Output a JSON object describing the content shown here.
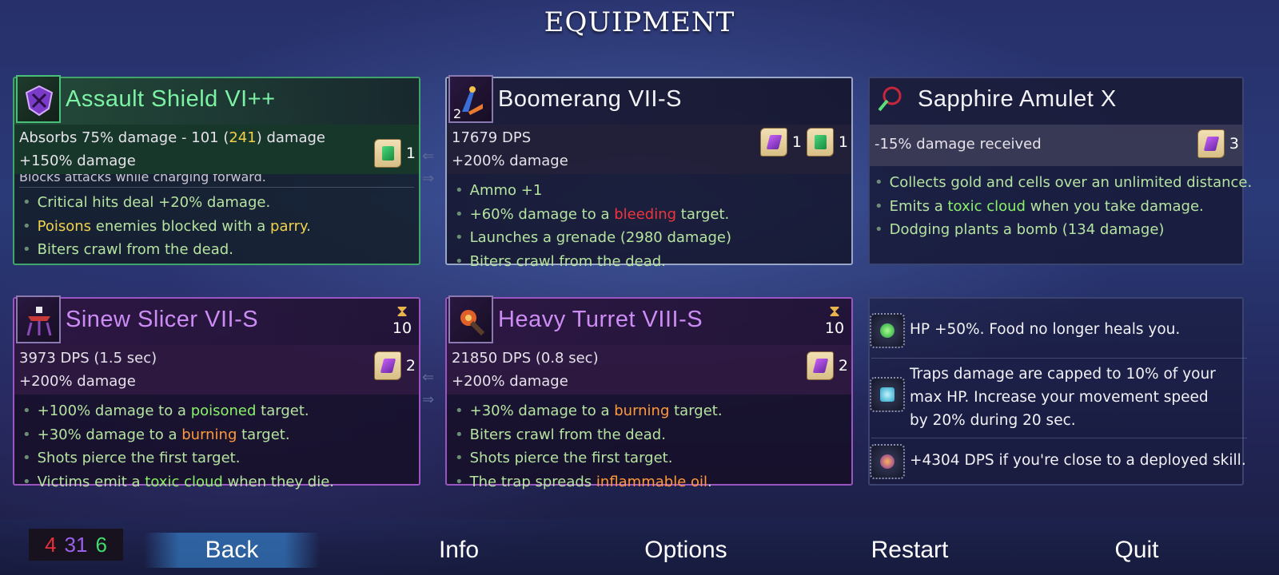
{
  "screen_title": "EQUIPMENT",
  "cards": {
    "shield": {
      "name": "Assault Shield VI++",
      "stat1_a": "Absorbs 75% damage - 101 (",
      "stat1_b": "241",
      "stat1_c": ") damage",
      "stat2": "+150% damage",
      "scrolls": [
        {
          "icon": "green-scroll",
          "count": "1"
        }
      ],
      "cut_text": "Blocks attacks while charging forward.",
      "affixes": [
        {
          "text": "Critical hits deal +20% damage."
        },
        {
          "pre": "",
          "hl": "Poisons",
          "mid": " enemies blocked with a ",
          "hl2": "parry",
          "post": "."
        },
        {
          "text": "Biters crawl from the dead."
        }
      ]
    },
    "boomerang": {
      "name": "Boomerang VII-S",
      "icon_count": "2",
      "stat1": "17679 DPS",
      "stat2": "+200% damage",
      "scrolls": [
        {
          "icon": "purple-scroll",
          "count": "1"
        },
        {
          "icon": "green-scroll",
          "count": "1"
        }
      ],
      "affixes": [
        {
          "text": "Ammo +1"
        },
        {
          "pre": "+60% damage to a ",
          "hl": "bleeding",
          "post": " target."
        },
        {
          "text": "Launches a grenade (2980 damage)"
        },
        {
          "text": "Biters crawl from the dead."
        }
      ]
    },
    "amulet": {
      "name": "Sapphire Amulet X",
      "stat1": "-15% damage received",
      "scrolls": [
        {
          "icon": "purple-scroll",
          "count": "3"
        }
      ],
      "affixes": [
        {
          "text": "Collects gold and cells over an unlimited distance."
        },
        {
          "pre": "Emits a ",
          "hl": "toxic cloud",
          "post": " when you take damage."
        },
        {
          "text": "Dodging plants a bomb (134 damage)"
        }
      ]
    },
    "slicer": {
      "name": "Sinew Slicer VII-S",
      "timer": "10",
      "stat1": "3973 DPS (1.5 sec)",
      "stat2": "+200% damage",
      "scrolls": [
        {
          "icon": "purple-scroll",
          "count": "2"
        }
      ],
      "affixes": [
        {
          "pre": "+100% damage to a ",
          "hl": "poisoned",
          "post": " target."
        },
        {
          "pre": "+30% damage to a ",
          "hl": "burning",
          "post": " target."
        },
        {
          "text": "Shots pierce the first target."
        },
        {
          "pre": "Victims emit a ",
          "hl": "toxic cloud",
          "post": " when they die."
        }
      ]
    },
    "turret": {
      "name": "Heavy Turret VIII-S",
      "timer": "10",
      "stat1": "21850 DPS (0.8 sec)",
      "stat2": "+200% damage",
      "scrolls": [
        {
          "icon": "purple-scroll",
          "count": "2"
        }
      ],
      "affixes": [
        {
          "pre": "+30% damage to a ",
          "hl": "burning",
          "post": " target."
        },
        {
          "text": "Biters crawl from the dead."
        },
        {
          "text": "Shots pierce the first target."
        },
        {
          "pre": "The trap spreads ",
          "hl": "inflammable oil",
          "post": "."
        }
      ]
    }
  },
  "mutations": [
    {
      "icon": "green-mutation-icon",
      "text": "HP +50%. Food no longer heals you."
    },
    {
      "icon": "blue-mutation-icon",
      "text": "Traps damage are capped to 10% of your max HP. Increase your movement speed by 20% during 20 sec."
    },
    {
      "icon": "purple-mutation-icon",
      "text": "+4304 DPS if you're close to a deployed skill."
    }
  ],
  "counters": {
    "red": "4",
    "purple": "31",
    "green": "6"
  },
  "menu": {
    "back": "Back",
    "info": "Info",
    "options": "Options",
    "restart": "Restart",
    "quit": "Quit"
  },
  "colors": {
    "green_accent": "#3fa56a",
    "purple_accent": "#9a55c2",
    "highlight_red": "#f0343d",
    "highlight_orange": "#ff9a3c",
    "highlight_yellow": "#f1d24d"
  }
}
